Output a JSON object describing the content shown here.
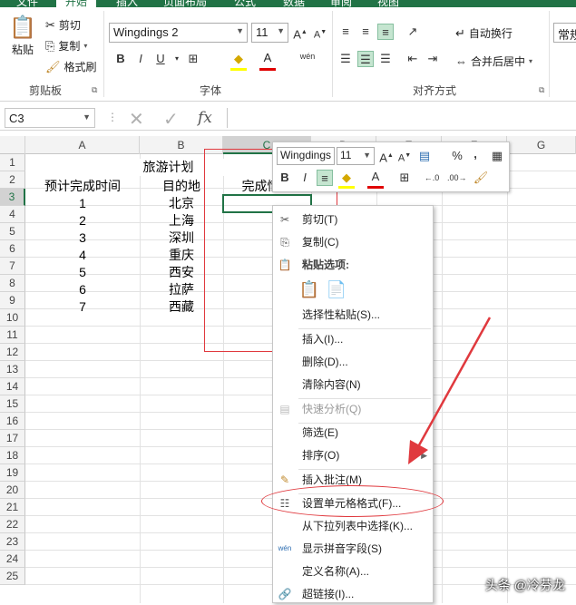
{
  "ribbon": {
    "tabs": [
      "文件",
      "开始",
      "插入",
      "页面布局",
      "公式",
      "数据",
      "审阅",
      "视图"
    ],
    "clipboard": {
      "paste": "粘贴",
      "cut": "剪切",
      "copy": "复制",
      "format_painter": "格式刷",
      "label": "剪贴板"
    },
    "font": {
      "name": "Wingdings 2",
      "size": "11",
      "label": "字体",
      "bold": "B",
      "italic": "I",
      "underline": "U",
      "phonetic": "wén"
    },
    "alignment": {
      "wrap_text": "自动换行",
      "merge_center": "合并后居中",
      "label": "对齐方式"
    },
    "number": {
      "format": "常规"
    }
  },
  "formula_bar": {
    "name_box": "C3",
    "fx": "fx"
  },
  "grid": {
    "columns": [
      "A",
      "B",
      "C",
      "D",
      "E",
      "F",
      "G"
    ],
    "rows": [
      "1",
      "2",
      "3",
      "4",
      "5",
      "6",
      "7",
      "8",
      "9",
      "10",
      "11",
      "12",
      "13",
      "14",
      "15",
      "16",
      "17",
      "18",
      "19",
      "20",
      "21",
      "22",
      "23",
      "24",
      "25"
    ],
    "title": "旅游计划",
    "headers": [
      "预计完成时间",
      "目的地",
      "完成情况"
    ],
    "data": [
      [
        "1",
        "北京"
      ],
      [
        "2",
        "上海"
      ],
      [
        "3",
        "深圳"
      ],
      [
        "4",
        "重庆"
      ],
      [
        "5",
        "西安"
      ],
      [
        "6",
        "拉萨"
      ],
      [
        "7",
        "西藏"
      ]
    ]
  },
  "mini_toolbar": {
    "font": "Wingdings",
    "size": "11",
    "percent": "%",
    "comma": ","
  },
  "context_menu": {
    "cut": "剪切(T)",
    "copy": "复制(C)",
    "paste_options": "粘贴选项:",
    "paste_special": "选择性粘贴(S)...",
    "insert": "插入(I)...",
    "delete": "删除(D)...",
    "clear": "清除内容(N)",
    "quick_analysis": "快速分析(Q)",
    "filter": "筛选(E)",
    "sort": "排序(O)",
    "insert_comment": "插入批注(M)",
    "format_cells": "设置单元格格式(F)...",
    "pick_list": "从下拉列表中选择(K)...",
    "phonetic": "显示拼音字段(S)",
    "define_name": "定义名称(A)...",
    "hyperlink": "超链接(I)..."
  },
  "watermark": "头条 @冷芬龙",
  "colors": {
    "excel_green": "#217346",
    "annotation_red": "#e0393e"
  }
}
